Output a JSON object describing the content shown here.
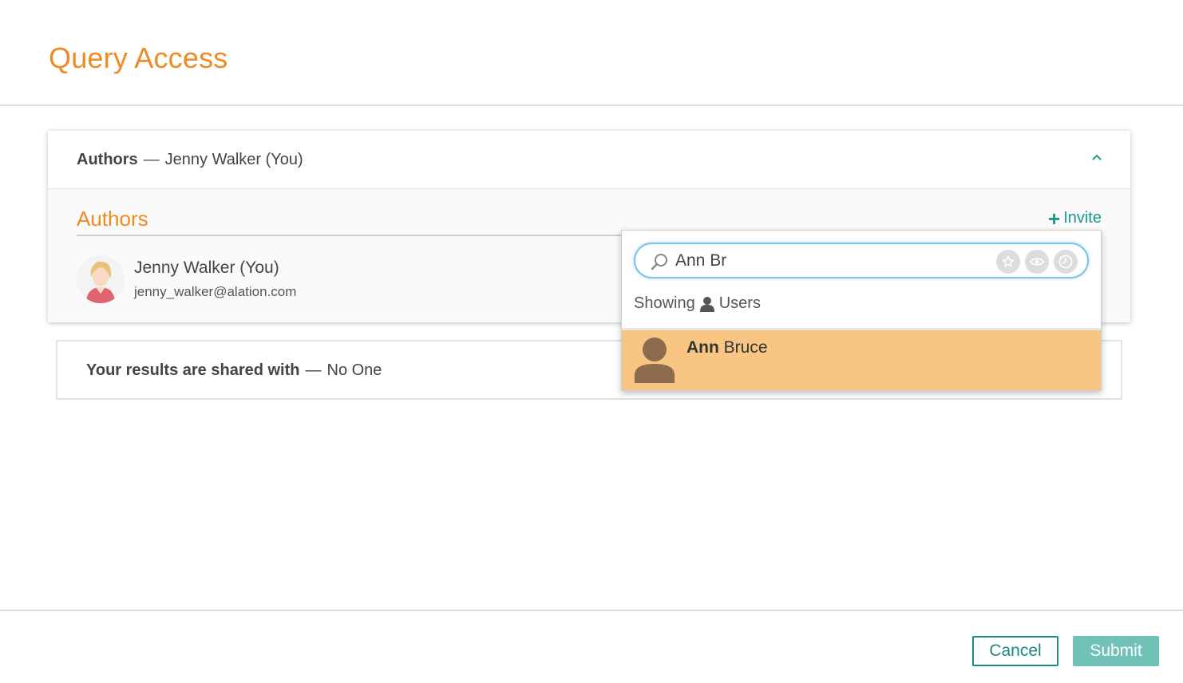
{
  "page": {
    "title": "Query Access"
  },
  "authors_panel": {
    "header_label": "Authors",
    "header_separator": "—",
    "header_value": "Jenny Walker (You)",
    "section_title": "Authors",
    "invite_label": "Invite",
    "authors": [
      {
        "name": "Jenny Walker (You)",
        "email": "jenny_walker@alation.com"
      }
    ]
  },
  "shared_panel": {
    "label": "Your results are shared with",
    "separator": "—",
    "value": "No One"
  },
  "search_dropdown": {
    "query": "Ann Br",
    "showing_label": "Showing",
    "showing_scope": "Users",
    "filters": [
      "star-icon",
      "eye-icon",
      "clock-icon"
    ],
    "results": [
      {
        "name_match": "Ann",
        "name_rest": " Bruce"
      }
    ],
    "highlight_color": "#f9c583"
  },
  "footer": {
    "cancel_label": "Cancel",
    "submit_label": "Submit"
  },
  "colors": {
    "accent_orange": "#f08a24",
    "accent_teal": "#1a9a8c",
    "submit_bg": "#72c1b7"
  }
}
